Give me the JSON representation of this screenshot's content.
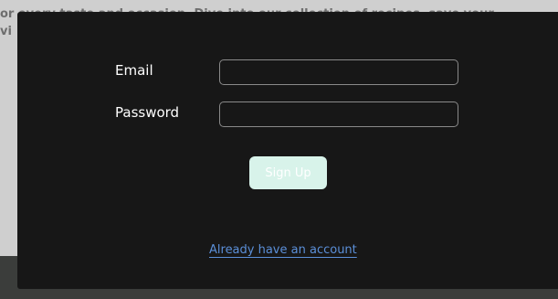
{
  "background": {
    "line1": "or every taste and occasion. Dive into our collection of recipes, save your",
    "line2": "vi"
  },
  "form": {
    "email_label": "Email",
    "email_value": "",
    "password_label": "Password",
    "password_value": "",
    "signup_label": "Sign Up",
    "signin_link": "Already have an account"
  },
  "colors": {
    "modal_bg": "#171717",
    "button_bg": "#d8f3ea",
    "link": "#5b8fd8"
  }
}
